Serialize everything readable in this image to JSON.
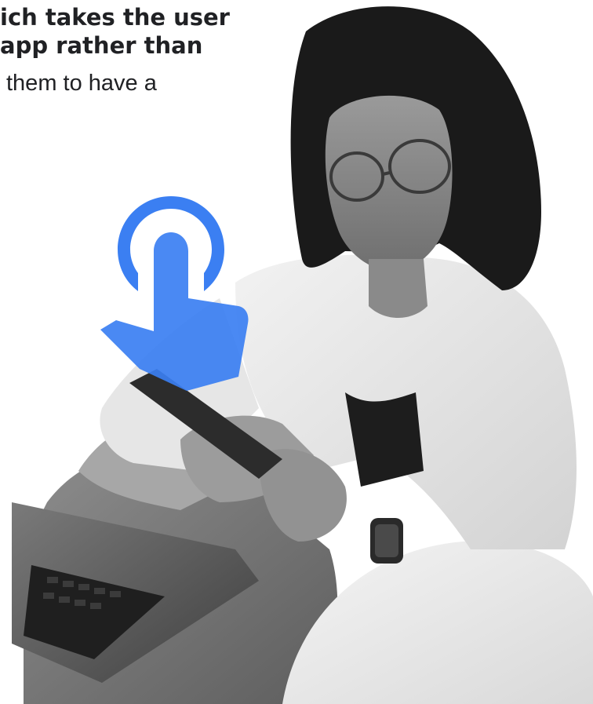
{
  "copy": {
    "line1": "ich takes the user",
    "line2": "app rather than",
    "line3": "them to have a"
  },
  "icons": {
    "tap": "touch-tap-icon"
  },
  "colors": {
    "accent": "#3b7ff2",
    "text": "#202124"
  }
}
